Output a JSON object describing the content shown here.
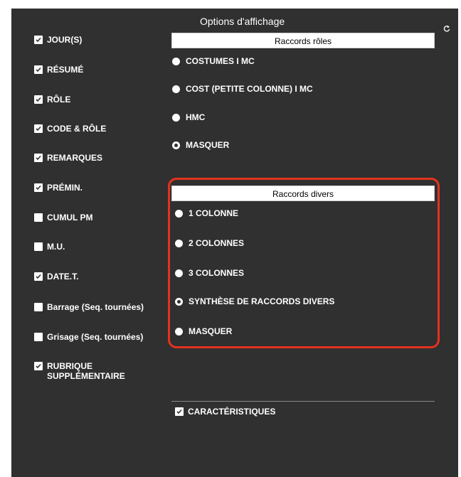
{
  "header": {
    "title": "Options d'affichage",
    "refresh_icon": "refresh-icon"
  },
  "left_options": [
    {
      "label": "JOUR(S)",
      "checked": true
    },
    {
      "label": "RÉSUMÉ",
      "checked": true
    },
    {
      "label": "RÔLE",
      "checked": true
    },
    {
      "label": "CODE & RÔLE",
      "checked": true
    },
    {
      "label": "REMARQUES",
      "checked": true
    },
    {
      "label": "PRÉMIN.",
      "checked": true
    },
    {
      "label": "CUMUL PM",
      "checked": false
    },
    {
      "label": "M.U.",
      "checked": false
    },
    {
      "label": "DATE.T.",
      "checked": true
    },
    {
      "label": "Barrage (Seq. tournées)",
      "checked": false
    },
    {
      "label": "Grisage (Seq. tournées)",
      "checked": false
    },
    {
      "label": "RUBRIQUE SUPPLÉMENTAIRE",
      "line1": "RUBRIQUE",
      "line2": "SUPPLÉMENTAIRE",
      "checked": true
    }
  ],
  "raccords_roles": {
    "header": "Raccords rôles",
    "options": [
      {
        "label": "COSTUMES I MC",
        "selected": false
      },
      {
        "label": "COST (PETITE COLONNE) I MC",
        "selected": false
      },
      {
        "label": "HMC",
        "selected": false
      },
      {
        "label": "MASQUER",
        "selected": true
      }
    ]
  },
  "raccords_divers": {
    "header": "Raccords divers",
    "options": [
      {
        "label": "1 COLONNE",
        "selected": false
      },
      {
        "label": "2 COLONNES",
        "selected": false
      },
      {
        "label": "3 COLONNES",
        "selected": false
      },
      {
        "label": "SYNTHÈSE DE RACCORDS DIVERS",
        "selected": true
      },
      {
        "label": "MASQUER",
        "selected": false
      }
    ]
  },
  "caracteristiques": {
    "label": "CARACTÉRISTIQUES",
    "checked": true
  },
  "colors": {
    "panel_bg": "#303030",
    "highlight": "#e5321e",
    "text": "#ffffff",
    "header_bg": "#ffffff"
  }
}
